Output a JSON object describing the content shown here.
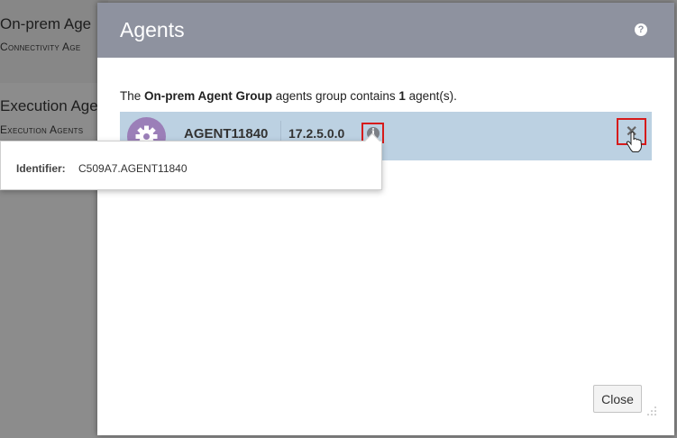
{
  "background": {
    "card1_title": "On-prem Age",
    "card1_subtitle": "Connectivity Age",
    "card2_title": "Execution Age",
    "card2_subtitle": "Execution Agents"
  },
  "dialog": {
    "title": "Agents",
    "help_icon": "?",
    "summary": {
      "prefix": "The ",
      "group_name": "On-prem Agent Group",
      "middle": " agents group contains ",
      "count": "1",
      "suffix": " agent(s)."
    },
    "agent": {
      "name": "AGENT11840",
      "version": "17.2.5.0.0",
      "avatar_icon": "gear-icon",
      "info_icon": "i",
      "remove_icon": "✕"
    },
    "close_label": "Close"
  },
  "tooltip": {
    "label": "Identifier:",
    "value": "C509A7.AGENT11840"
  },
  "colors": {
    "header": "#8e929f",
    "row_selected": "#bcd1e2",
    "avatar": "#9b7fb8",
    "highlight_box": "#d61b1b"
  }
}
